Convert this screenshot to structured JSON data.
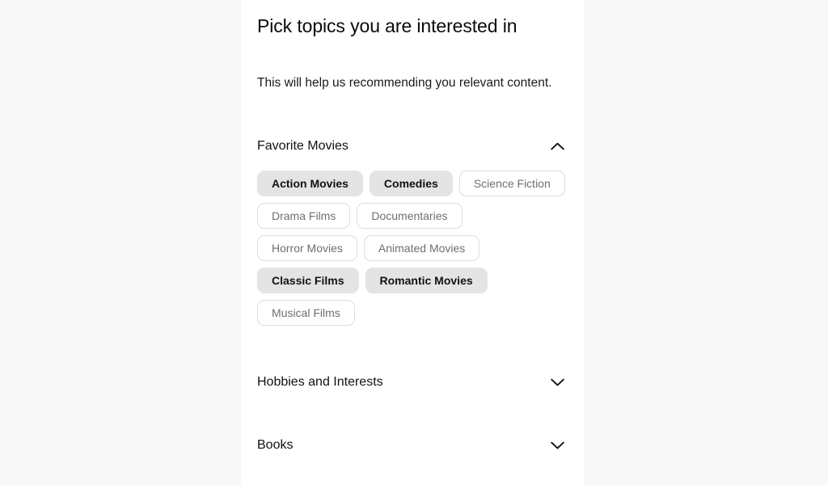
{
  "page": {
    "title": "Pick topics you are interested in",
    "subtitle": "This will help us recommending you relevant content.",
    "background_color": "#f8f8f8",
    "column_background_color": "#ffffff"
  },
  "colors": {
    "chip_selected_background": "#e4e4e4",
    "chip_selected_text": "#121212",
    "chip_unselected_background": "#ffffff",
    "chip_unselected_border": "#dcdcdc",
    "chip_unselected_text": "#6f6f6f",
    "heading_text": "#0b0b0b"
  },
  "sections": [
    {
      "id": "favorite-movies",
      "title": "Favorite Movies",
      "expanded": true,
      "chevron_icon": "chevron-up-icon",
      "chips": [
        {
          "label": "Action Movies",
          "selected": true
        },
        {
          "label": "Comedies",
          "selected": true
        },
        {
          "label": "Science Fiction",
          "selected": false
        },
        {
          "label": "Drama Films",
          "selected": false
        },
        {
          "label": "Documentaries",
          "selected": false
        },
        {
          "label": "Horror Movies",
          "selected": false
        },
        {
          "label": "Animated Movies",
          "selected": false
        },
        {
          "label": "Classic Films",
          "selected": true
        },
        {
          "label": "Romantic Movies",
          "selected": true
        },
        {
          "label": "Musical Films",
          "selected": false
        }
      ]
    },
    {
      "id": "hobbies-and-interests",
      "title": "Hobbies and Interests",
      "expanded": false,
      "chevron_icon": "chevron-down-icon",
      "chips": []
    },
    {
      "id": "books",
      "title": "Books",
      "expanded": false,
      "chevron_icon": "chevron-down-icon",
      "chips": []
    }
  ]
}
